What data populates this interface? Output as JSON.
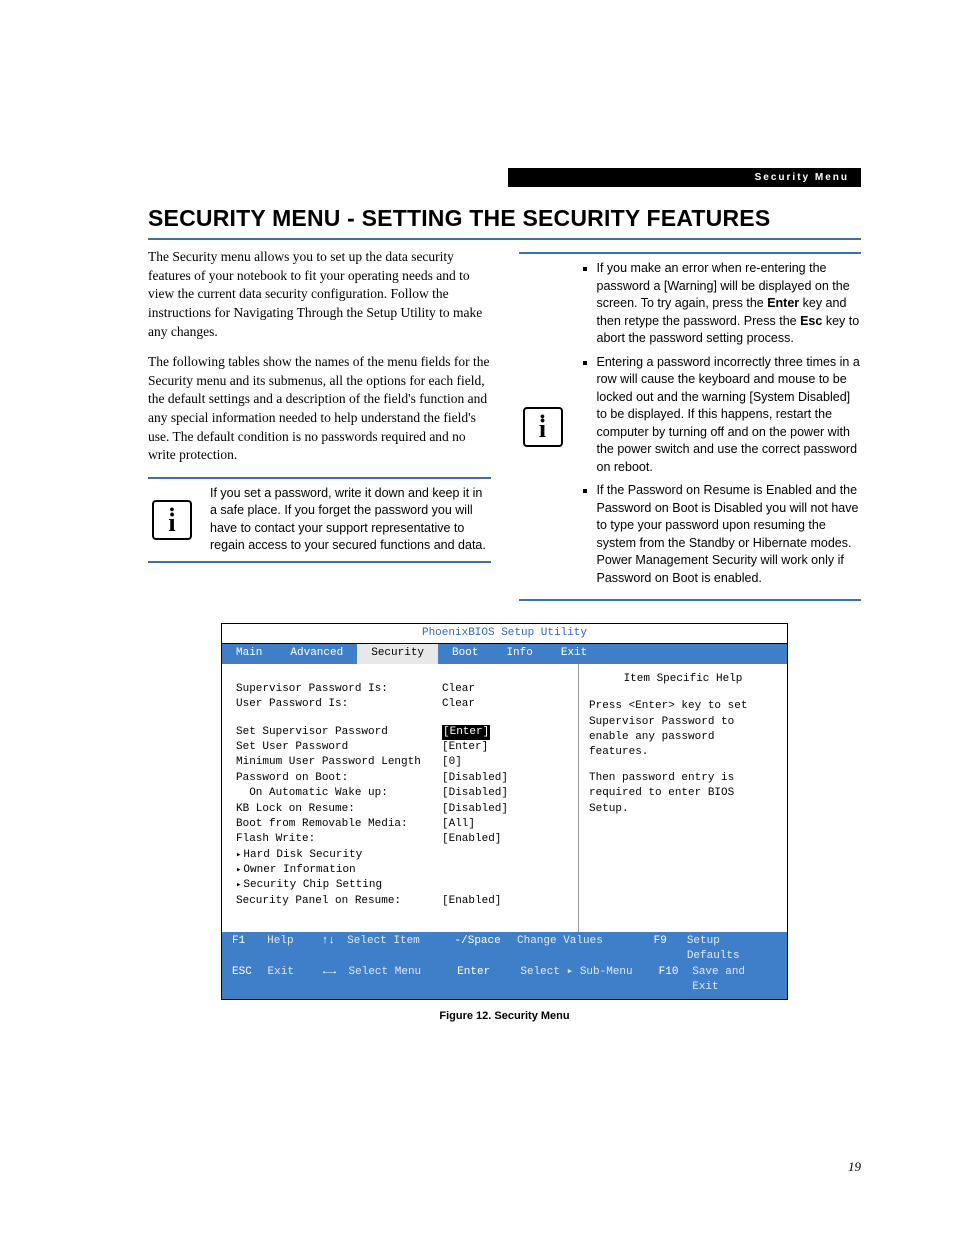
{
  "header_label": "Security Menu",
  "title": "SECURITY MENU - SETTING THE SECURITY FEATURES",
  "intro_p1": "The Security menu allows you to set up the data security features of your notebook to fit your operating needs and to view the current data security configuration. Follow the instructions for Navigating Through the Setup Utility to make any changes.",
  "intro_p2": "The following tables show the names of the menu fields for the Security menu and its submenus, all the options for each field, the default settings and a description of the field's function and any special information needed to help understand the field's use. The default condition is no passwords required and no write protection.",
  "note1": "If you set a password, write it down and keep it in a safe place. If you forget the password you will have to contact your support representative to regain access to your secured functions and data.",
  "note2_items": [
    {
      "pre": "If you make an error when re-entering the password a [Warning] will be displayed on the screen. To try again, press the ",
      "k1": "Enter",
      "mid": " key and then retype the password. Press the ",
      "k2": "Esc",
      "post": " key to abort the password setting process."
    },
    {
      "text": "Entering a password incorrectly three times in a row will cause the keyboard and mouse to be locked out and the warning [System Disabled] to be displayed. If this happens, restart the computer by turning off and on the power with the power switch and use the correct password on reboot."
    },
    {
      "text": "If the Password on Resume is Enabled and the Password on Boot is Disabled you will not have to type your password upon resuming the system from the Standby or Hibernate modes. Power Management Security will work only if Password on Boot is enabled."
    }
  ],
  "bios": {
    "title": "PhoenixBIOS Setup Utility",
    "tabs": [
      "Main",
      "Advanced",
      "Security",
      "Boot",
      "Info",
      "Exit"
    ],
    "active_tab": 2,
    "rows": [
      {
        "label": "Supervisor Password Is:",
        "value": "Clear"
      },
      {
        "label": "User Password Is:",
        "value": "Clear"
      },
      {
        "spacer": true
      },
      {
        "label": "Set Supervisor Password",
        "value": "[Enter]",
        "hl": true
      },
      {
        "label": "Set User Password",
        "value": "[Enter]"
      },
      {
        "label": "Minimum User Password Length",
        "value": "[0]"
      },
      {
        "label": "Password on Boot:",
        "value": "[Disabled]"
      },
      {
        "label": "  On Automatic Wake up:",
        "value": "[Disabled]"
      },
      {
        "label": "KB Lock on Resume:",
        "value": "[Disabled]"
      },
      {
        "label": "Boot from Removable Media:",
        "value": "[All]"
      },
      {
        "label": "Flash Write:",
        "value": "[Enabled]"
      },
      {
        "label": "Hard Disk Security",
        "value": "",
        "arrow": true
      },
      {
        "label": "Owner Information",
        "value": "",
        "arrow": true
      },
      {
        "label": "Security Chip Setting",
        "value": "",
        "arrow": true
      },
      {
        "label": "Security Panel on Resume:",
        "value": "[Enabled]"
      }
    ],
    "help_title": "Item Specific Help",
    "help_p1": "Press <Enter> key to set Supervisor Password to enable any password features.",
    "help_p2": "Then password entry is required to enter BIOS Setup.",
    "foot": {
      "r1": {
        "k1": "F1",
        "l1": "Help",
        "a1": "↑↓",
        "s1": "Select Item",
        "mk": "-/Space",
        "ml": "Change Values",
        "rk": "F9",
        "rl": "Setup Defaults"
      },
      "r2": {
        "k1": "ESC",
        "l1": "Exit",
        "a1": "←→",
        "s1": "Select Menu",
        "mk": "Enter",
        "ml_pre": "Select ",
        "ml_post": " Sub-Menu",
        "rk": "F10",
        "rl": "Save and Exit"
      }
    }
  },
  "caption": "Figure 12.  Security Menu",
  "page_number": "19"
}
